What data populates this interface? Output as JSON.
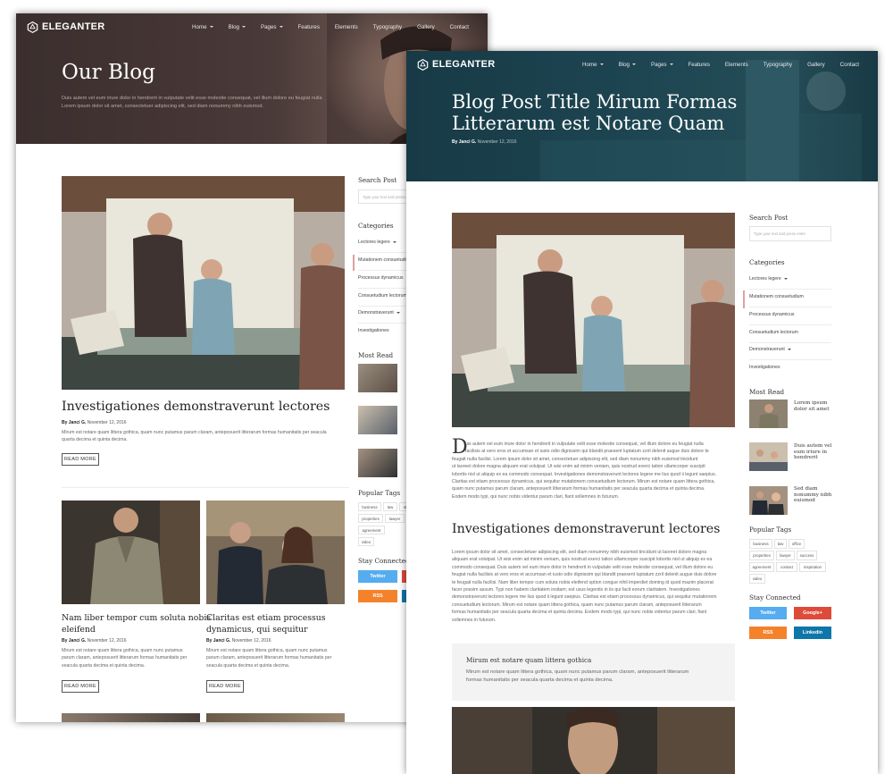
{
  "colors": {
    "twitter": "#55acee",
    "google": "#dd4b39",
    "rss": "#f4822a",
    "linkedin": "#0e76a8",
    "hero_left": "#3a2c2c",
    "hero_right": "#183f4c"
  },
  "nav": {
    "logo": "ELEGANTER",
    "items": [
      "Home",
      "Blog",
      "Pages",
      "Features",
      "Elements",
      "Typography",
      "Gallery",
      "Contact"
    ]
  },
  "blog": {
    "hero_title": "Our Blog",
    "hero_text_1": "Duis autem vel eum iriure dolor in hendrerit in vulputate velit esse molestie consequat, vel illum dolore eu feugiat nulla",
    "hero_text_2": "Lorem ipsum dolor sit amet, consectetuer adipiscing elit, sed diam nonummy nibh euismod.",
    "post1": {
      "title": "Investigationes demonstraverunt lectores",
      "author": "By Janci G.",
      "date": "November 12, 2016",
      "excerpt_1": "Mirum est notare quam littera gothica, quam nunc putamus parum claram, anteposuerit litterarum formas humanitatis per seacula",
      "excerpt_2": "quarta decima et quinta decima.",
      "button": "READ MORE"
    },
    "post2": {
      "title_1": "Nam liber tempor cum soluta nobis",
      "title_2": "eleifend",
      "author": "By Janci G.",
      "date": "November 12, 2016",
      "excerpt_1": "Mirum est notare quam littera gothica, quam nunc putamus",
      "excerpt_2": "parum claram, anteposuerit litterarum formas humanitatis per",
      "excerpt_3": "seacula quarta decima et quinta decima.",
      "button": "READ MORE"
    },
    "post3": {
      "title_1": "Claritas est etiam processus",
      "title_2": "dynamicus, qui sequitur",
      "author": "By Janci G.",
      "date": "November 12, 2016",
      "excerpt_1": "Mirum est notare quam littera gothica, quam nunc putamus",
      "excerpt_2": "parum claram, anteposuerit litterarum formas humanitatis per",
      "excerpt_3": "seacula quarta decima et quinta decima.",
      "button": "READ MORE"
    },
    "sidebar": {
      "search_title": "Search Post",
      "search_placeholder": "Type your text and press enter",
      "categories_title": "Categories",
      "categories": [
        "Lectores legere",
        "Mutationem consuetudium",
        "Processus dynamicus",
        "Consuetudium lectorum",
        "Demonstraverunt",
        "Investigationes"
      ],
      "most_read_title": "Most Read",
      "tags_title": "Popular Tags",
      "tags": [
        "business",
        "law",
        "office",
        "properties",
        "lawyer",
        "agreement",
        "video"
      ],
      "stay_title": "Stay Connected",
      "twitter": "Twitter",
      "rss": "RSS"
    }
  },
  "single": {
    "title_1": "Blog Post Title Mirum Formas",
    "title_2": "Litterarum est Notare Quam",
    "author": "By Janci G.",
    "date": "November 12, 2016",
    "dropcap": "D",
    "p1": [
      "uis autem vel eum iriure dolor in hendrerit in vulputate velit esse molestie consequat, vel illum dolore eu feugiat nulla",
      "facilisis at vero eros et accumsan et iusto odio dignissim qui blandit praesent luptatum zzril delenit augue duis dolore te",
      "feugait nulla facilisi. Lorem ipsum dolor sit amet, consectetuer adipiscing elit, sed diam nonummy nibh euismod tincidunt",
      "ut laoreet dolore magna aliquam erat volutpat. Ut wisi enim ad minim veniam, quis nostrud exerci tation ullamcorper suscipit",
      "lobortis nisl ut aliquip ex ea commodo consequat. Investigationes demonstraverunt lectores legere me lius quod ii legunt saepius.",
      "Claritas est etiam processus dynamicus, qui sequitur mutationem consuetudium lectorum. Mirum est notare quam littera gothica,",
      "quam nunc putamus parum claram, anteposuerit litterarum formas humanitatis per seacula quarta decima et quinta decima.",
      "Eodem modo typi, qui nunc nobis videntur parum clari, fiant sollemnes in futurum."
    ],
    "h2": "Investigationes demonstraverunt lectores",
    "p2": [
      "Lorem ipsum dolor sit amet, consectetuer adipiscing elit, sed diam nonummy nibh euismod tincidunt ut laoreet dolore magna",
      "aliquam erat volutpat. Ut wisi enim ad minim veniam, quis nostrud exerci tation ullamcorper suscipit lobortis nisl ut aliquip ex ea",
      "commodo consequat. Duis autem vel eum iriure dolor in hendrerit in vulputate velit esse molestie consequat, vel illum dolore eu",
      "feugiat nulla facilisis at vero eros et accumsan et iusto odio dignissim qui blandit praesent luptatum zzril delenit augue duis dolore",
      "te feugait nulla facilisi. Nam liber tempor cum soluta nobis eleifend option congue nihil imperdiet doming id quod mazim placerat",
      "facer possim assum. Typi non habent claritatem insitam; est usus legentis in iis qui facit eorum claritatem. Investigationes",
      "demonstraverunt lectores legere me lius quod ii legunt saepius. Claritas est etiam processus dynamicus, qui sequitur mutationem",
      "consuetudium lectorum. Mirum est notare quam littera gothica, quam nunc putamus parum claram, anteposuerit litterarum",
      "formas humanitatis per seacula quarta decima et quinta decima. Eodem modo typi, qui nunc nobis videntur parum clari, fiant",
      "sollemnes in futurum."
    ],
    "quote_title": "Mirum est notare quam littera gothica",
    "quote_1": "Mirum est notare quam littera gothica, quam nunc putamus parum claram, anteposuerit litterarum",
    "quote_2": "formas humanitatis per seacula quarta decima et quinta decima.",
    "sidebar": {
      "search_title": "Search Post",
      "search_placeholder": "Type your text and press enter",
      "categories_title": "Categories",
      "categories": [
        "Lectores legere",
        "Mutationem consuetudium",
        "Processus dynamicus",
        "Consuetudium lectorum",
        "Demonstraverunt",
        "Investigationes"
      ],
      "most_read_title": "Most Read",
      "most_read": [
        {
          "l1": "Lorem ipsum",
          "l2": "dolor sit amet"
        },
        {
          "l1": "Duis autem vel",
          "l2": "eum iriure in",
          "l3": "hendrerit"
        },
        {
          "l1": "Sed diam",
          "l2": "nonummy nibh",
          "l3": "euismod"
        }
      ],
      "tags_title": "Popular Tags",
      "tags": [
        "business",
        "law",
        "office",
        "properties",
        "lawyer",
        "success",
        "agreement",
        "contact",
        "inspiration",
        "video"
      ],
      "stay_title": "Stay Connected",
      "twitter": "Twitter",
      "google": "Google+",
      "rss": "RSS",
      "linkedin": "Linkedin"
    }
  }
}
